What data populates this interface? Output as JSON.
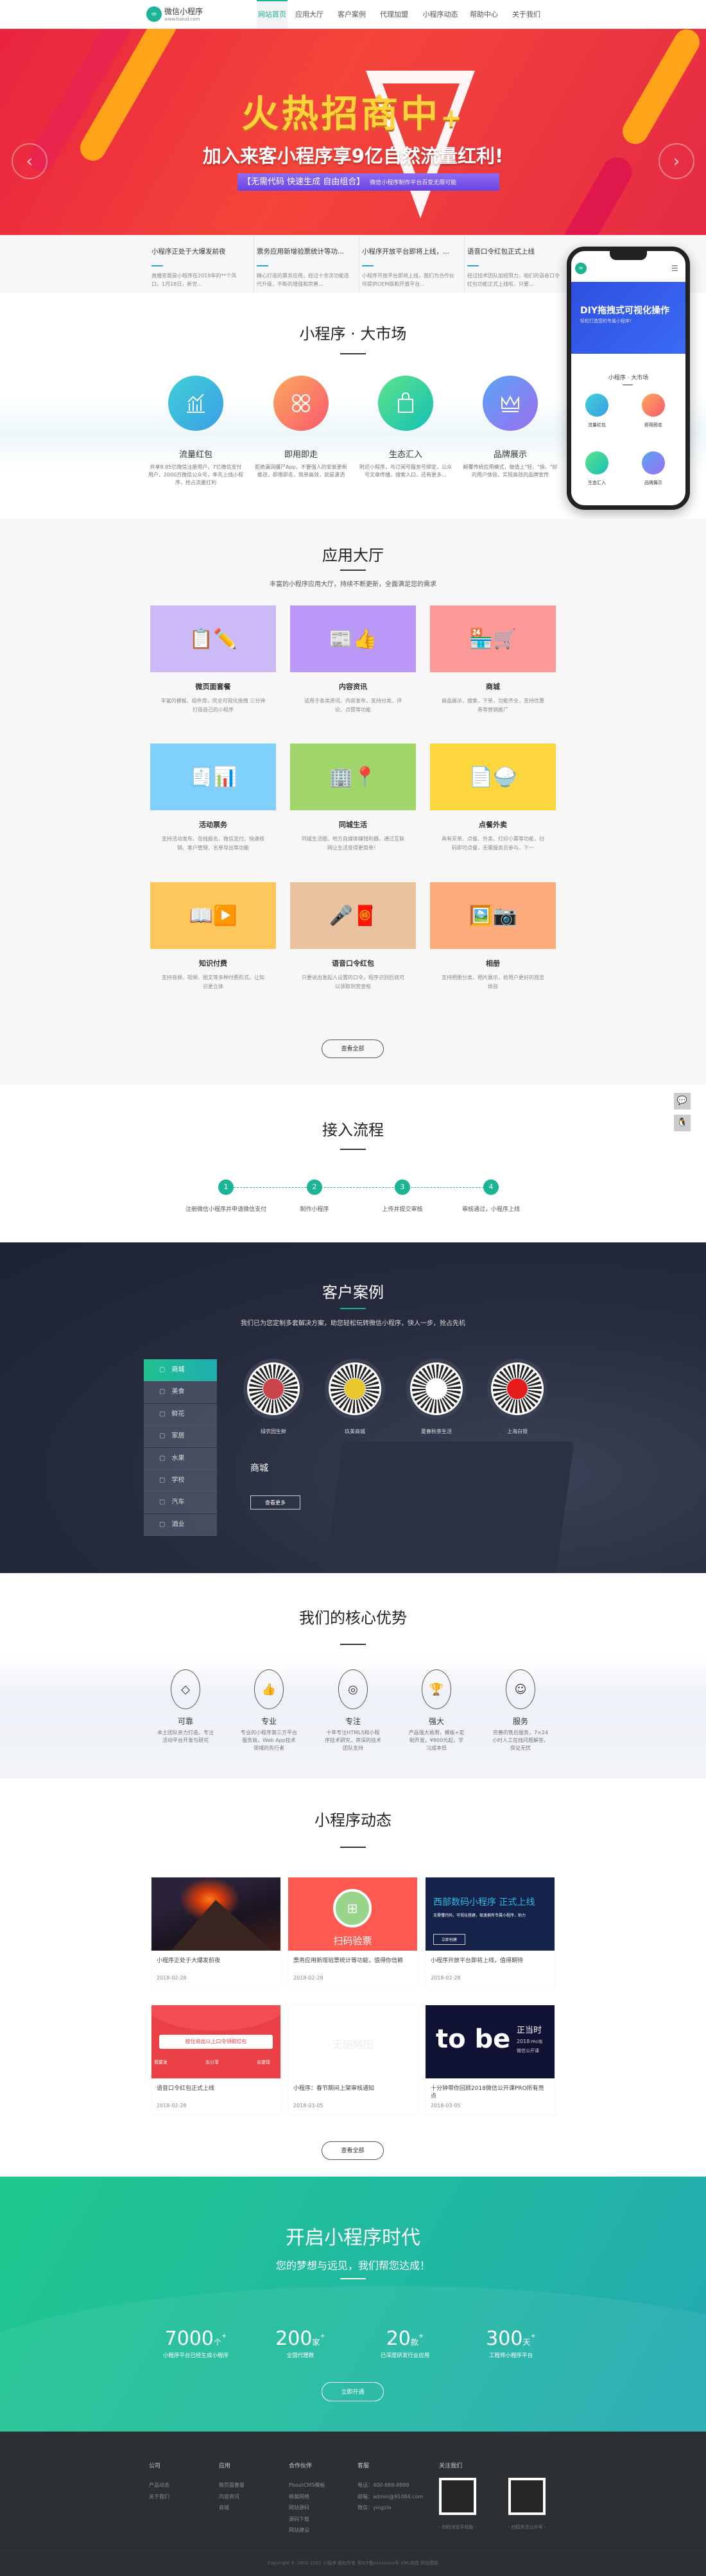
{
  "header": {
    "logo_icon": "infinity-logo-icon",
    "logo_title": "微信小程序",
    "logo_url": "www.baiud.com",
    "nav": [
      "网站首页",
      "应用大厅",
      "客户案例",
      "代理加盟",
      "小程序动态",
      "帮助中心",
      "关于我们"
    ],
    "active_nav": 0
  },
  "banner": {
    "title": "火热招商中",
    "plus": "+",
    "subtitle": "加入来客小程序享9亿自然流量红利!",
    "tag": "【无需代码  快速生成  自由组合】",
    "tag_note": "微信小程序制作平台百变无限可能",
    "prev_icon": "chevron-left-icon",
    "next_icon": "chevron-right-icon",
    "slide_count": 2,
    "active_slide": 0,
    "colors": {
      "bg": "#ef3a3c",
      "title": "#ffd13a",
      "tag": "#7a56e8"
    }
  },
  "strip": [
    {
      "title": "小程序正处于大爆发前夜",
      "desc": "直播答题是小程序在2018年的**个风口。1月18日，新世..."
    },
    {
      "title": "票务应用新增验票统计等功...",
      "desc": "精心打造的票务应用，经过十余次功能迭代升级，不断的增强和完善..."
    },
    {
      "title": "小程序开放平台即将上线，...",
      "desc": "小程序开放平台即将上线，我们为合作伙伴提供OEM版和开放平台..."
    },
    {
      "title": "语音口令红包正式上线",
      "desc": "经过技术团队加班努力，咱们的语音口令红包功能正式上线啦，只要..."
    }
  ],
  "phone": {
    "banner_title": "DIY拖拽式可视化操作",
    "banner_sub": "轻松打造您的专属小程序!",
    "section": "小程序 · 大市场",
    "items": [
      "流量红包",
      "即用即走",
      "生态汇入",
      "品牌展示"
    ]
  },
  "market": {
    "title": "小程序 · 大市场",
    "items": [
      {
        "icon": "chart-up-icon",
        "label": "流量红包",
        "desc": "共享9.85亿微信注册用户，7亿微信支付用户，2000万微信公众号，率先上线小程序，抢占流量红利",
        "color": "#3fbde0"
      },
      {
        "icon": "command-icon",
        "label": "即用即走",
        "desc": "拒绝漏洞僵尸App，不要强人的安装更新推送，即用即走，简单高效，就是潇洒",
        "color": "#f87a63"
      },
      {
        "icon": "shopping-bag-icon",
        "label": "生态汇入",
        "desc": "附近小程序，与订阅号服务号绑定，公众号文章传播，搜索入口，还有更多...",
        "color": "#2fcf9d"
      },
      {
        "icon": "crown-icon",
        "label": "品牌展示",
        "desc": "颠覆传统应用模式，做值上\"轻、\"快、\"好的用户体验，实现高效的品牌宣传",
        "color": "#7a8af2"
      }
    ]
  },
  "hall": {
    "title": "应用大厅",
    "subtitle": "丰富的小程序应用大厅，持续不断更新，全面满足您的需求",
    "button": "查看全部",
    "cards": [
      {
        "title": "微页面套餐",
        "desc": "丰富的模板、组件库，完全可视化拖拽 三分钟打造自己的小程序",
        "color": "#cbbaf6",
        "icon": "document-edit-icon",
        "glyph": "📋✏️"
      },
      {
        "title": "内容资讯",
        "desc": "适用于各类资讯、内容发布，支持分类、评论、点赞等功能",
        "color": "#b998f7",
        "icon": "newspaper-thumbs-up-icon",
        "glyph": "📰👍"
      },
      {
        "title": "商城",
        "desc": "商品展示，搜索，下单，功能齐全，支持优惠券等营销推广",
        "color": "#fd9a98",
        "icon": "store-cart-icon",
        "glyph": "🏪🛒"
      },
      {
        "title": "活动票务",
        "desc": "支持活动发布、在线报名、微信支付、快速核销、客户管理、名单导出等功能",
        "color": "#80d0fd",
        "icon": "ticket-chart-icon",
        "glyph": "🧾📊"
      },
      {
        "title": "同城生活",
        "desc": "同城生活圈，地方自媒体赚钱利器，通过互联网让生活变得更简单！",
        "color": "#a0d56b",
        "icon": "building-location-icon",
        "glyph": "🏢📍"
      },
      {
        "title": "点餐外卖",
        "desc": "具有买单、点餐、外卖、打印小票等功能，扫码即可点餐，无需服务员参与，下一",
        "color": "#fdd53d",
        "icon": "menu-rice-bowl-icon",
        "glyph": "📄🍚"
      },
      {
        "title": "知识付费",
        "desc": "支持音频、视频、图文等多种付费形式，让知识更立体",
        "color": "#fdc75b",
        "icon": "book-video-icon",
        "glyph": "📖▶️"
      },
      {
        "title": "语音口令红包",
        "desc": "只要说出发起人设置的口令，程序识别后就可以领取到赏金啦",
        "color": "#e9c39f",
        "icon": "microphone-red-envelope-icon",
        "glyph": "🎤🧧"
      },
      {
        "title": "相册",
        "desc": "支持相册分类，相片展示，给用户更好的观览体验",
        "color": "#fdab7d",
        "icon": "picture-camera-icon",
        "glyph": "🖼️📷"
      }
    ]
  },
  "process": {
    "title": "接入流程",
    "steps": [
      {
        "n": "1",
        "label": "注册微信小程序并申请微信支付"
      },
      {
        "n": "2",
        "label": "制作小程序"
      },
      {
        "n": "3",
        "label": "上传并提交审核"
      },
      {
        "n": "4",
        "label": "审核通过，小程序上线"
      }
    ],
    "color": "#1cb495"
  },
  "cases": {
    "title": "客户案例",
    "subtitle": "我们已为您定制多套解决方案，助您轻松玩转微信小程序，快人一步，抢占先机",
    "categories": [
      "商城",
      "美食",
      "鲜花",
      "家居",
      "水果",
      "学校",
      "汽车",
      "酒业"
    ],
    "active": 0,
    "qrcodes": [
      {
        "label": "绿农园生鲜",
        "center": "#c9454a"
      },
      {
        "label": "玖美商城",
        "center": "#e8c62c"
      },
      {
        "label": "夏春秋茶生活",
        "center": "#ffffff"
      },
      {
        "label": "上海白银",
        "center": "#e51b1b"
      }
    ],
    "current": "商城",
    "button": "查看更多"
  },
  "advantages": {
    "title": "我们的核心优势",
    "items": [
      {
        "icon": "diamond-icon",
        "title": "可靠",
        "desc": "本土团队亲力打造，专注活动平台开发与研究"
      },
      {
        "icon": "thumbs-up-icon",
        "title": "专业",
        "desc": "专业的小程序第三方平台服务商，Web App技术领域的先行者"
      },
      {
        "icon": "target-icon",
        "title": "专注",
        "desc": "十年专注HTML5和小程序技术研究，资深的技术团队支持"
      },
      {
        "icon": "trophy-icon",
        "title": "强大",
        "desc": "产品强大易用，模板+定制开发，¥800元起，学习成本低"
      },
      {
        "icon": "customer-service-icon",
        "title": "服务",
        "desc": "完善的售后服务，7×24小时人工在线问题解答，保证无忧"
      }
    ]
  },
  "news": {
    "title": "小程序动态",
    "button": "查看全部",
    "items": [
      {
        "title": "小程序正处于大爆发前夜",
        "date": "2018-02-28",
        "img": "volcano"
      },
      {
        "title": "票务应用新增验票统计等功能，值得你信赖",
        "date": "2018-02-28",
        "img": "scan",
        "img_text": "扫码验票"
      },
      {
        "title": "小程序开放平台即将上线，值得期待",
        "date": "2018-02-28",
        "img": "xibu",
        "img_text": "西部数码小程序 正式上线",
        "img_sub": "无需懂代码，可视化搭建，极速拥有专属小程序，助力",
        "img_btn": "立即创建"
      },
      {
        "title": "语音口令红包正式上线",
        "date": "2018-02-28",
        "img": "redpacket",
        "img_text": "按住说出以上口令领取红包",
        "img_actions": [
          "我要发",
          "去分享",
          "去提现"
        ]
      },
      {
        "title": "小程序：春节期间上架审核通知",
        "date": "2018-03-05",
        "img": "none",
        "img_text": "无缩略图"
      },
      {
        "title": "十分钟带你回顾2018微信公开课PRO所有亮点",
        "date": "2018-03-05",
        "img": "tobe",
        "img_text": "to be",
        "img_side": "正当时",
        "img_year": "2018",
        "img_pro": "PRO版",
        "img_course": "微信公开课"
      }
    ]
  },
  "cta": {
    "title": "开启小程序时代",
    "subtitle": "您的梦想与远见，我们帮您达成！",
    "button": "立即开通",
    "stats": [
      {
        "num": "7000",
        "unit": "个",
        "plus": "+",
        "label": "小程序平台已经生成小程序"
      },
      {
        "num": "200",
        "unit": "家",
        "plus": "+",
        "label": "全国代理数"
      },
      {
        "num": "20",
        "unit": "款",
        "plus": "+",
        "label": "已深度研发行业应用"
      },
      {
        "num": "300",
        "unit": "天",
        "plus": "+",
        "label": "工程师小程序平台"
      }
    ]
  },
  "footer": {
    "cols": [
      {
        "title": "公司",
        "items": [
          "产品动态",
          "关于我们"
        ]
      },
      {
        "title": "应用",
        "items": [
          "微页面套餐",
          "内容资讯",
          "商城"
        ]
      },
      {
        "title": "合作伙伴",
        "items": [
          "PbootCMS模板",
          "格展网络",
          "网站源码",
          "源码下载",
          "网站建设"
        ]
      },
      {
        "title": "客服",
        "items": [
          "电话：400-888-8888",
          "邮箱：admin@91084.com",
          "微信：yingzia"
        ]
      }
    ],
    "follow": "关注我们",
    "qr": [
      "- 扫码浏览手机版 -",
      "- 扫码关注公众号 -"
    ],
    "copyright": "Copyright © 2002-2022 小程序 版权所有 粤ICP备xxxxxxxx号 XML地图 网站模板"
  },
  "float": [
    {
      "icon": "wechat-icon"
    },
    {
      "icon": "qq-icon"
    }
  ]
}
